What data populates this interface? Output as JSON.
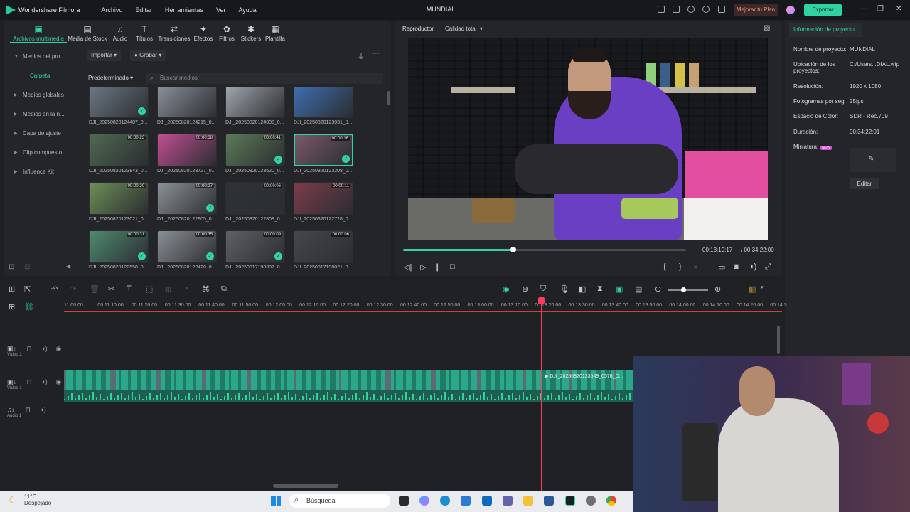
{
  "app": {
    "name": "Wondershare Filmora",
    "project_title": "MUNDIAL"
  },
  "menu": [
    "Archivo",
    "Editar",
    "Herramientas",
    "Ver",
    "Ayuda"
  ],
  "titlebar": {
    "upgrade_label": "Mejorar tu Plan",
    "export_label": "Exportar"
  },
  "media_tabs": [
    {
      "label": "Archivos multimedia",
      "icon": "media-icon"
    },
    {
      "label": "Media de Stock",
      "icon": "stock-icon"
    },
    {
      "label": "Audio",
      "icon": "music-icon"
    },
    {
      "label": "Títulos",
      "icon": "text-icon"
    },
    {
      "label": "Transiciones",
      "icon": "transition-icon"
    },
    {
      "label": "Efectos",
      "icon": "effects-icon"
    },
    {
      "label": "Filtros",
      "icon": "filter-icon"
    },
    {
      "label": "Stickers",
      "icon": "sticker-icon"
    },
    {
      "label": "Plantilla",
      "icon": "template-icon"
    }
  ],
  "sidebar": [
    "Medios del pro...",
    "Carpeta",
    "Medios globales",
    "Medios en la n...",
    "Capa de ajuste",
    "Clip compuesto",
    "Influence Kit"
  ],
  "media_toolbar": {
    "import_label": "Importar",
    "record_label": "Grabar",
    "sort_label": "Predeterminado",
    "search_placeholder": "Buscar medios"
  },
  "media_items": [
    {
      "name": "DJI_20250820124407_0...",
      "duration": "",
      "checked": true,
      "color": "#6c7884"
    },
    {
      "name": "DJI_20250820124215_0...",
      "duration": "",
      "checked": false,
      "color": "#8a909a"
    },
    {
      "name": "DJI_20250820124038_0...",
      "duration": "",
      "checked": false,
      "color": "#a0a6ad"
    },
    {
      "name": "DJI_20250820123931_0...",
      "duration": "",
      "checked": false,
      "color": "#3f6fb0"
    },
    {
      "name": "DJI_20250820123843_0...",
      "duration": "00:00:23",
      "checked": false,
      "color": "#4f6a52"
    },
    {
      "name": "DJI_20250820123727_0...",
      "duration": "00:00:38",
      "checked": false,
      "color": "#c14f93"
    },
    {
      "name": "DJI_20250820123520_0...",
      "duration": "00:00:41",
      "checked": true,
      "color": "#5b7a57"
    },
    {
      "name": "DJI_20250820123208_0...",
      "duration": "00:00:16",
      "checked": true,
      "color": "#7a5a6a"
    },
    {
      "name": "DJI_20250820123021_0...",
      "duration": "00:00:20",
      "checked": false,
      "color": "#6e8f58"
    },
    {
      "name": "DJI_20250820122905_0...",
      "duration": "00:00:27",
      "checked": true,
      "color": "#8c9296"
    },
    {
      "name": "DJI_20250820122808_0...",
      "duration": "00:00:06",
      "checked": false,
      "color": "#2e3338"
    },
    {
      "name": "DJI_20250820122728_0...",
      "duration": "00:00:11",
      "checked": false,
      "color": "#7c3c4c"
    },
    {
      "name": "DJI_20250820122558_0...",
      "duration": "00:00:31",
      "checked": true,
      "color": "#4f8a6f"
    },
    {
      "name": "DJI_20250820122420_0...",
      "duration": "00:00:35",
      "checked": true,
      "color": "#8b9096"
    },
    {
      "name": "DJI_20250817190307_0...",
      "duration": "00:00:09",
      "checked": true,
      "color": "#5f6064"
    },
    {
      "name": "DJI_20250817190021_0...",
      "duration": "00:00:06",
      "checked": false,
      "color": "#45474b"
    }
  ],
  "player": {
    "tab_label": "Reproductor",
    "quality_label": "Calidad total",
    "current_time": "00:13:19:17",
    "total_time": "/ 00:34:22:00",
    "progress": 0.39
  },
  "project_info": {
    "header": "Información de proyecto",
    "rows": [
      {
        "label": "Nombre de proyecto:",
        "value": "MUNDIAL"
      },
      {
        "label": "Ubicación de los proyectos:",
        "value": "C:/Users...DIAL.wfp"
      },
      {
        "label": "Resolución:",
        "value": "1920 x 1080"
      },
      {
        "label": "Fotogramas por seg",
        "value": "25fps"
      },
      {
        "label": "Espacio de Color:",
        "value": "SDR - Rec.709"
      },
      {
        "label": "Duración:",
        "value": "00:34:22:01"
      }
    ],
    "thumbnail_label": "Miniatura:",
    "new_badge": "NEW",
    "edit_label": "Editar"
  },
  "timeline": {
    "ticks": [
      "11:00:00",
      "00:11:10:00",
      "00:11:20:00",
      "00:11:30:00",
      "00:11:40:00",
      "00:11:50:00",
      "00:12:00:00",
      "00:12:10:00",
      "00:12:20:00",
      "00:12:30:00",
      "00:12:40:00",
      "00:12:50:00",
      "00:13:00:00",
      "00:13:10:00",
      "00:13:20:00",
      "00:13:30:00",
      "00:13:40:00",
      "00:13:50:00",
      "00:14:00:00",
      "00:14:10:00",
      "00:14:20:00",
      "00:14:3"
    ],
    "tracks": [
      {
        "num": "2",
        "label": "Vídeo 2"
      },
      {
        "num": "1",
        "label": "Vídeo 1"
      },
      {
        "num": "1",
        "label": "Audio 1"
      }
    ],
    "clip_label": "DJI_20250820133549_0576_D..."
  },
  "taskbar": {
    "temp": "11°C",
    "weather": "Despejado",
    "search": "Búsqueda"
  }
}
